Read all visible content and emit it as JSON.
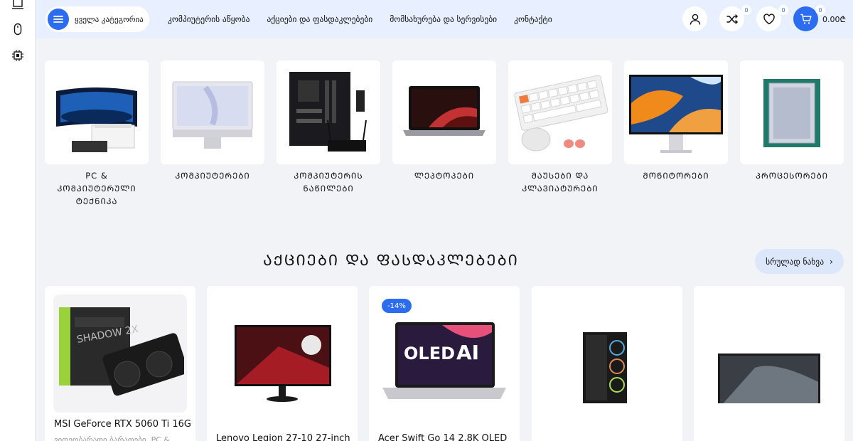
{
  "header": {
    "category_button": "ყველა კატეგორია",
    "nav": [
      "კომპიუტერის აწყობა",
      "აქციები და ფასდაკლებები",
      "მომსახურება და სერვისები",
      "კონტაქტი"
    ],
    "compare_count": "0",
    "wishlist_count": "0",
    "cart_count": "0",
    "cart_total": "0.00₾"
  },
  "categories": [
    "PC & ᲙᲝᲛᲞᲘᲣᲢᲔᲠᲣᲚᲘ ᲢᲔᲥᲜᲘᲙᲐ",
    "ᲙᲝᲛᲞᲘᲣᲢᲔᲠᲔᲑᲘ",
    "ᲙᲝᲛᲞᲘᲣᲢᲔᲠᲘᲡ ᲜᲐᲬᲘᲚᲔᲑᲘ",
    "ᲚᲔᲞᲢᲝᲞᲔᲑᲘ",
    "ᲛᲐᲣᲡᲔᲑᲘ ᲓᲐ ᲙᲚᲐᲕᲘᲐᲢᲣᲠᲔᲑᲘ",
    "ᲛᲝᲜᲘᲢᲝᲠᲔᲑᲘ",
    "ᲞᲠᲝᲪᲔᲡᲝᲠᲔᲑᲘ"
  ],
  "section": {
    "title": "ᲐᲥᲪᲘᲔᲑᲘ ᲓᲐ ᲤᲐᲡᲓᲐᲙᲚᲔᲑᲔᲑᲘ",
    "see_all": "სრულად ნახვა"
  },
  "products": [
    {
      "name": "MSI GeForce RTX 5060 Ti 16G",
      "sub": "ვიდეობარათი ბარათები, PC &"
    },
    {
      "name": "Lenovo Legion 27-10 27-inch"
    },
    {
      "name": "Acer Swift Go 14 2.8K OLED",
      "discount": "-14%"
    },
    {
      "name": ""
    },
    {
      "name": ""
    }
  ],
  "colors": {
    "accent": "#2b6cf0",
    "header_bg": "#e8efff",
    "page_bg": "#f2f3f7"
  }
}
